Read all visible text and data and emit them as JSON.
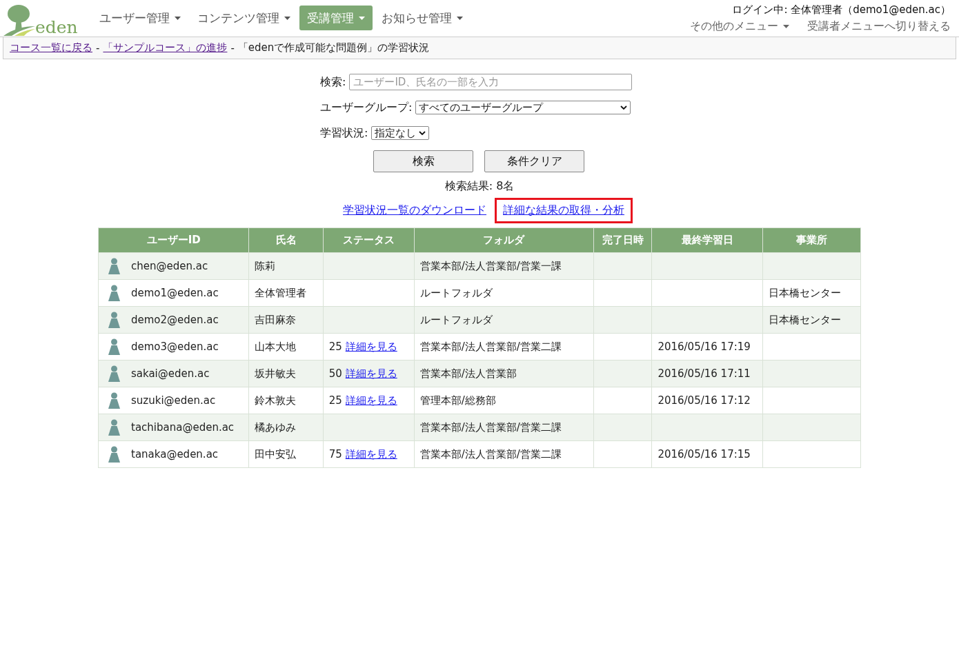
{
  "header": {
    "logo_text": "eden",
    "nav": [
      {
        "label": "ユーザー管理",
        "selected": false
      },
      {
        "label": "コンテンツ管理",
        "selected": false
      },
      {
        "label": "受講管理",
        "selected": true
      },
      {
        "label": "お知らせ管理",
        "selected": false
      }
    ],
    "login": "ログイン中: 全体管理者（demo1@eden.ac）",
    "menus": [
      {
        "label": "その他のメニュー",
        "dropdown": true
      },
      {
        "label": "受講者メニューへ切り替える",
        "dropdown": false
      }
    ]
  },
  "breadcrumb": {
    "links": [
      "コース一覧に戻る",
      "「サンプルコース」の進捗"
    ],
    "separator": "-",
    "current": "「edenで作成可能な問題例」の学習状況"
  },
  "search": {
    "label": "検索:",
    "placeholder": "ユーザーID、氏名の一部を入力",
    "group_label": "ユーザーグループ:",
    "group_value": "すべてのユーザーグループ",
    "status_label": "学習状況:",
    "status_value": "指定なし",
    "buttons": [
      "検索",
      "条件クリア"
    ],
    "result": "検索結果: 8名",
    "links": [
      {
        "label": "学習状況一覧のダウンロード",
        "highlighted": false
      },
      {
        "label": "詳細な結果の取得・分析",
        "highlighted": true
      }
    ]
  },
  "table": {
    "columns": [
      "ユーザーID",
      "氏名",
      "ステータス",
      "フォルダ",
      "完了日時",
      "最終学習日",
      "事業所"
    ],
    "rows": [
      {
        "user_id": "chen@eden.ac",
        "name": "陈莉",
        "folder": "営業本部/法人営業部/営業一課"
      },
      {
        "user_id": "demo1@eden.ac",
        "name": "全体管理者",
        "folder": "ルートフォルダ",
        "office": "日本橋センター"
      },
      {
        "user_id": "demo2@eden.ac",
        "name": "吉田麻奈",
        "folder": "ルートフォルダ",
        "office": "日本橋センター"
      },
      {
        "user_id": "demo3@eden.ac",
        "name": "山本大地",
        "score": "25",
        "detail": "詳細を見る",
        "folder": "営業本部/法人営業部/営業二課",
        "last": "2016/05/16 17:19"
      },
      {
        "user_id": "sakai@eden.ac",
        "name": "坂井敏夫",
        "score": "50",
        "detail": "詳細を見る",
        "folder": "営業本部/法人営業部",
        "last": "2016/05/16 17:11"
      },
      {
        "user_id": "suzuki@eden.ac",
        "name": "鈴木敦夫",
        "score": "25",
        "detail": "詳細を見る",
        "folder": "管理本部/総務部",
        "last": "2016/05/16 17:12"
      },
      {
        "user_id": "tachibana@eden.ac",
        "name": "橘あゆみ",
        "folder": "営業本部/法人営業部/営業二課"
      },
      {
        "user_id": "tanaka@eden.ac",
        "name": "田中安弘",
        "score": "75",
        "detail": "詳細を見る",
        "folder": "営業本部/法人営業部/営業二課",
        "last": "2016/05/16 17:15"
      }
    ]
  }
}
